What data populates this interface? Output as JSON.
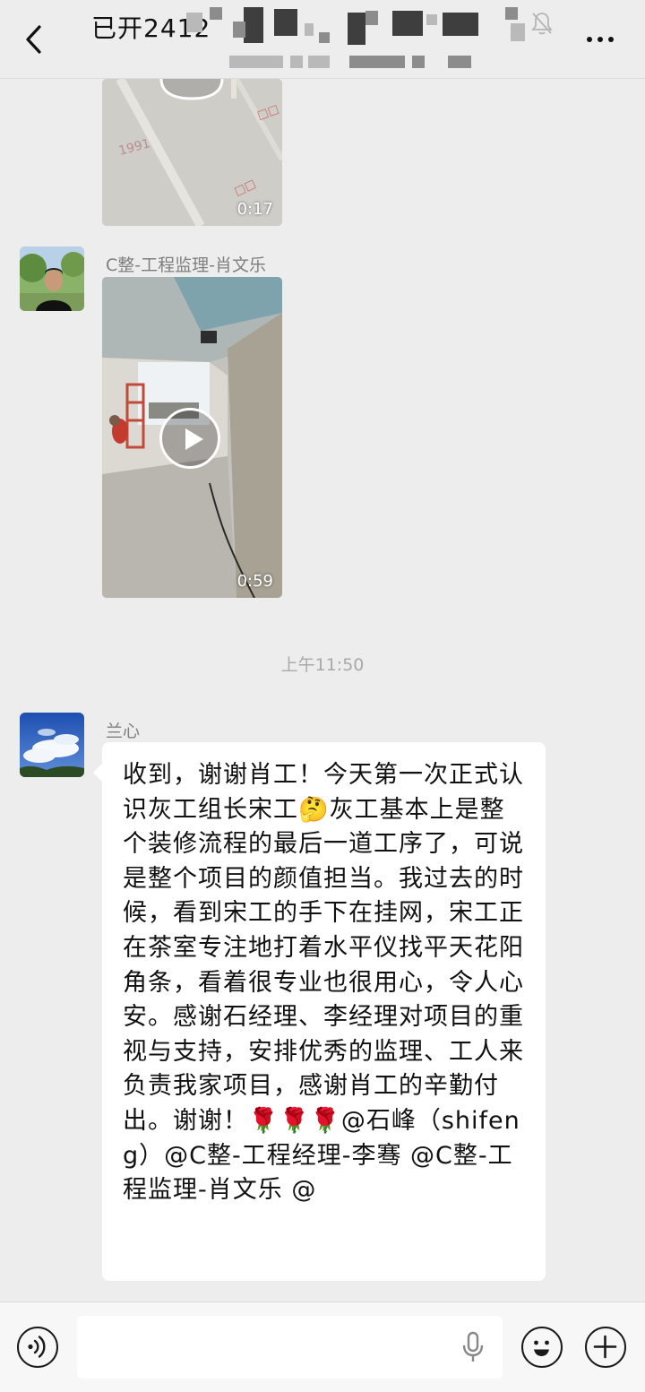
{
  "header": {
    "title": "已开2412"
  },
  "messages": [
    {
      "type": "video",
      "duration": "0:17"
    },
    {
      "type": "video",
      "sender": "C整-工程监理-肖文乐",
      "duration": "0:59"
    },
    {
      "type": "time",
      "text": "上午11:50"
    },
    {
      "type": "text",
      "sender": "兰心",
      "text": "收到，谢谢肖工！今天第一次正式认识灰工组长宋工🤔灰工基本上是整个装修流程的最后一道工序了，可说是整个项目的颜值担当。我过去的时候，看到宋工的手下在挂网，宋工正在茶室专注地打着水平仪找平天花阳角条，看着很专业也很用心，令人心安。感谢石经理、李经理对项目的重视与支持，安排优秀的监理、工人来负责我家项目，感谢肖工的辛勤付出。谢谢！🌹🌹🌹@石峰（shifeng）@C整-工程经理-李骞 @C整-工程监理-肖文乐 @"
    }
  ],
  "input": {
    "value": ""
  },
  "icons": {
    "back": "chevron-left-icon",
    "mute": "bell-muted-icon",
    "more": "more-horizontal-icon",
    "voice": "voice-icon",
    "mic": "microphone-icon",
    "emoji": "emoji-icon",
    "add": "plus-icon"
  }
}
